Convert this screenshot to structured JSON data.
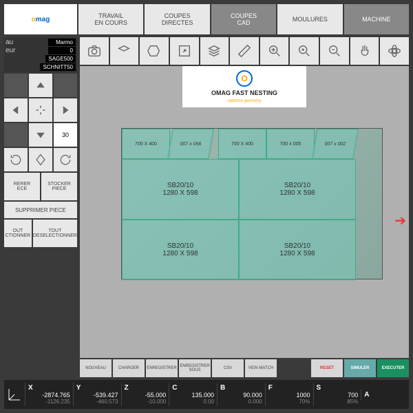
{
  "tabs": {
    "travail": "TRAVAIL\nEN COURS",
    "coupes_directes": "COUPES\nDIRECTES",
    "coupes_cad": "COUPES\nCAD",
    "moulures": "MOULURES",
    "machine": "MACHINE"
  },
  "sidebar": {
    "material_label": "au",
    "material": "Marmo",
    "thickness_label": "eur",
    "thickness": "0",
    "param1": "SAGE500",
    "param2": "SCHNITT50",
    "step": "30",
    "liberer": "RERER\nECE",
    "stocker": "STOCKER\nPIECE",
    "supprimer": "SUPPRIMER PIECE",
    "tout_sel": "OUT\nCTIONNER",
    "tout_desel": "TOUT\nDESELECTIONNER"
  },
  "nesting": {
    "title": "OMAG FAST NESTING",
    "subtitle": "optimize geometry"
  },
  "slab": {
    "top_pieces": [
      "700 X 400",
      "007 x 056",
      "700 X 400",
      "700 x 005",
      "007 x 002"
    ],
    "main_label": "SB20/10",
    "main_dim": "1280 X 598"
  },
  "filebar": {
    "nouveau": "NOUVEAU",
    "charger": "CHARGER",
    "enregistrer": "ENREGISTRER",
    "enregistrer_sous": "ENREGISTRER\nSOUS",
    "csv": "CSV",
    "vein": "VEIN MATCH",
    "reset": "RESET",
    "simuler": "SIMULER",
    "executer": "EXECUTER"
  },
  "axes": {
    "X": {
      "v1": "-2874.765",
      "v2": "-1126.235"
    },
    "Y": {
      "v1": "-539.427",
      "v2": "-460.573"
    },
    "Z": {
      "v1": "-55.000",
      "v2": "-10.000"
    },
    "C": {
      "v1": "135.000",
      "v2": "0.00"
    },
    "B": {
      "v1": "90.000",
      "v2": "0.000"
    },
    "F": {
      "v1": "1000",
      "v2": "70%"
    },
    "S": {
      "v1": "700",
      "v2": "85%"
    },
    "A": {
      "v1": "",
      "v2": ""
    }
  }
}
